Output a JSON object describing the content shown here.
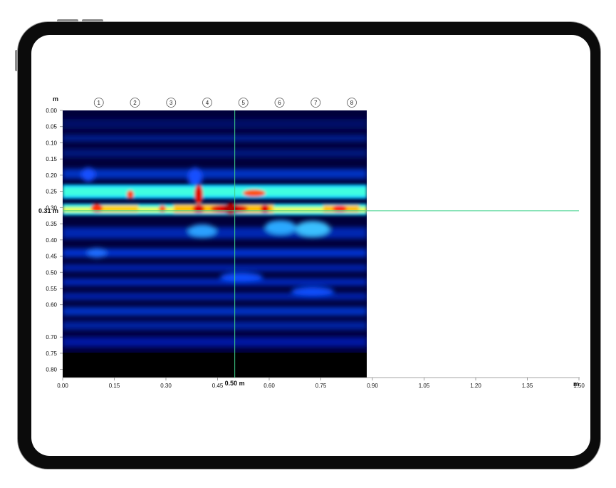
{
  "chart_data": {
    "type": "heatmap",
    "xlabel": "m",
    "ylabel": "m",
    "xlim": [
      0.0,
      1.5
    ],
    "ylim": [
      0.0,
      0.825
    ],
    "x_ticks": [
      "0.00",
      "0.15",
      "0.30",
      "0.45",
      "0.60",
      "0.75",
      "0.90",
      "1.05",
      "1.20",
      "1.35",
      "1.50"
    ],
    "y_ticks": [
      "0.00",
      "0.05",
      "0.10",
      "0.15",
      "0.20",
      "0.25",
      "0.30",
      "0.35",
      "0.40",
      "0.45",
      "0.50",
      "0.55",
      "0.60",
      "0.70",
      "0.75",
      "0.80"
    ],
    "scan_extent": {
      "x": [
        0.0,
        0.94
      ],
      "y": [
        0.0,
        0.755
      ]
    },
    "channels": [
      {
        "label": "1",
        "x": 0.105
      },
      {
        "label": "2",
        "x": 0.21
      },
      {
        "label": "3",
        "x": 0.315
      },
      {
        "label": "4",
        "x": 0.42
      },
      {
        "label": "5",
        "x": 0.525
      },
      {
        "label": "6",
        "x": 0.63
      },
      {
        "label": "7",
        "x": 0.735
      },
      {
        "label": "8",
        "x": 0.84
      }
    ],
    "cursor_x": {
      "value": 0.5,
      "label": "0.50 m"
    },
    "cursor_y": {
      "value": 0.31,
      "label": "0.31 m"
    },
    "colors": {
      "cursor": "#3fd08a",
      "low": "#000028",
      "high": "#e00000"
    }
  }
}
